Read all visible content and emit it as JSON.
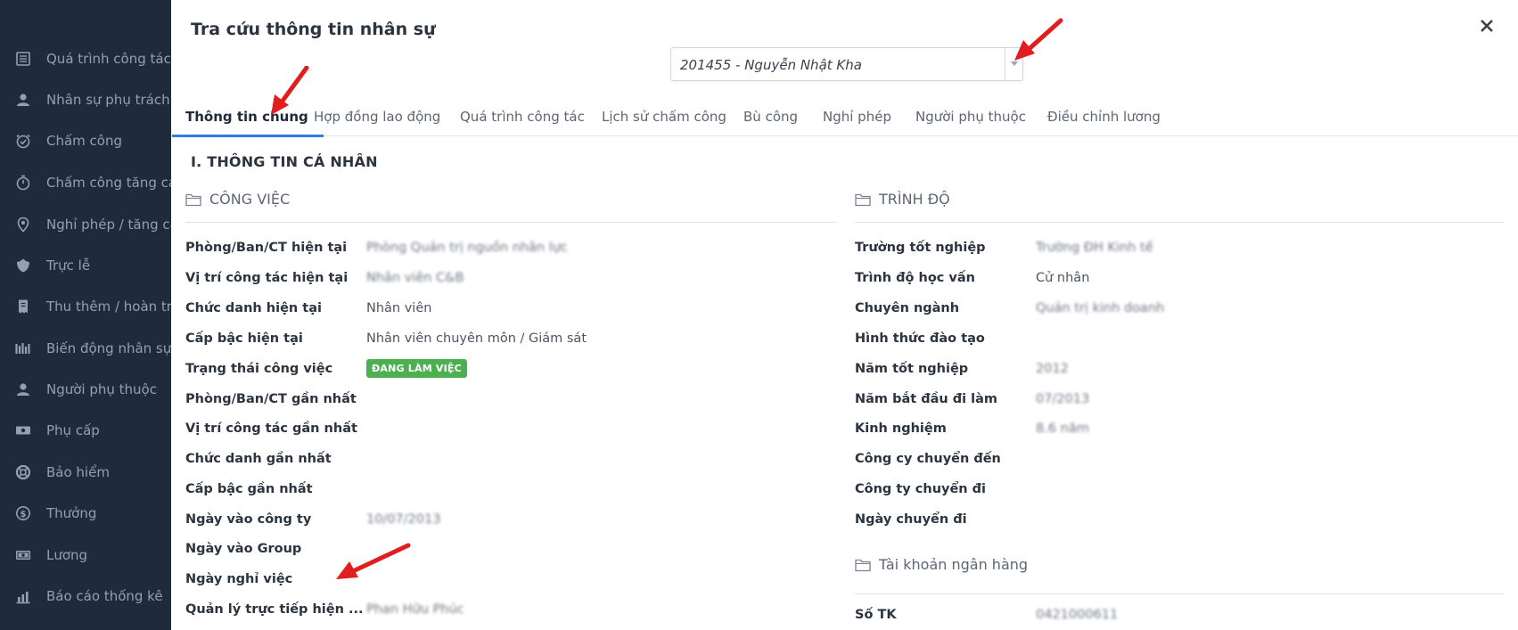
{
  "sidebar": {
    "items": [
      {
        "label": "Quá trình công tác n",
        "icon": "list-icon"
      },
      {
        "label": "Nhân sự phụ trách",
        "icon": "user-icon"
      },
      {
        "label": "Chấm công",
        "icon": "clock-check-icon"
      },
      {
        "label": "Chấm công tăng ca",
        "icon": "stopwatch-icon"
      },
      {
        "label": "Nghỉ phép / tăng ca",
        "icon": "location-icon"
      },
      {
        "label": "Trực lễ",
        "icon": "shield-icon"
      },
      {
        "label": "Thu thêm / hoàn trả",
        "icon": "receipt-icon"
      },
      {
        "label": "Biến động nhân sự",
        "icon": "wave-icon"
      },
      {
        "label": "Người phụ thuộc",
        "icon": "user-icon"
      },
      {
        "label": "Phụ cấp",
        "icon": "money-icon"
      },
      {
        "label": "Bảo hiểm",
        "icon": "lifebuoy-icon"
      },
      {
        "label": "Thưởng",
        "icon": "dollar-icon"
      },
      {
        "label": "Lương",
        "icon": "cash-icon"
      },
      {
        "label": "Báo cáo thống kê",
        "icon": "chart-icon"
      }
    ]
  },
  "modal": {
    "title": "Tra cứu thông tin nhân sự",
    "employee_select": {
      "value": "201455 - Nguyễn Nhật Kha"
    },
    "tabs": [
      {
        "label": "Thông tin chung",
        "active": true
      },
      {
        "label": "Hợp đồng lao động",
        "active": false
      },
      {
        "label": "Quá trình công tác",
        "active": false
      },
      {
        "label": "Lịch sử chấm công",
        "active": false
      },
      {
        "label": "Bù công",
        "active": false
      },
      {
        "label": "Nghỉ phép",
        "active": false
      },
      {
        "label": "Người phụ thuộc",
        "active": false
      },
      {
        "label": "Điều chỉnh lương",
        "active": false
      }
    ],
    "section_heading": "I. THÔNG TIN CÁ NHÂN",
    "work": {
      "title": "CÔNG VIỆC",
      "rows": [
        {
          "label": "Phòng/Ban/CT hiện tại",
          "value": "Phòng Quản trị nguồn nhân lực"
        },
        {
          "label": "Vị trí công tác hiện tại",
          "value": "Nhân viên C&B"
        },
        {
          "label": "Chức danh hiện tại",
          "value": "Nhân viên"
        },
        {
          "label": "Cấp bậc hiện tại",
          "value": "Nhân viên chuyên môn / Giám sát"
        },
        {
          "label": "Trạng thái công việc",
          "value": ""
        },
        {
          "label": "Phòng/Ban/CT gần nhất",
          "value": ""
        },
        {
          "label": "Vị trí công tác gần nhất",
          "value": ""
        },
        {
          "label": "Chức danh gần nhất",
          "value": ""
        },
        {
          "label": "Cấp bậc gần nhất",
          "value": ""
        },
        {
          "label": "Ngày vào công ty",
          "value": "10/07/2013"
        },
        {
          "label": "Ngày vào Group",
          "value": ""
        },
        {
          "label": "Ngày nghỉ việc",
          "value": ""
        },
        {
          "label": "Quản lý trực tiếp hiện ...",
          "value": "Phan Hữu Phúc"
        }
      ],
      "status_badge": "ĐANG LÀM VIỆC"
    },
    "education": {
      "title": "TRÌNH ĐỘ",
      "rows": [
        {
          "label": "Trường tốt nghiệp",
          "value": "Trường ĐH Kinh tế"
        },
        {
          "label": "Trình độ học vấn",
          "value": "Cử nhân"
        },
        {
          "label": "Chuyên ngành",
          "value": "Quản trị kinh doanh"
        },
        {
          "label": "Hình thức đào tạo",
          "value": ""
        },
        {
          "label": "Năm tốt nghiệp",
          "value": "2012"
        },
        {
          "label": "Năm bắt đầu đi làm",
          "value": "07/2013"
        },
        {
          "label": "Kinh nghiệm",
          "value": "8.6 năm"
        },
        {
          "label": "Công cy chuyển đến",
          "value": ""
        },
        {
          "label": "Công ty chuyển đi",
          "value": ""
        },
        {
          "label": "Ngày chuyển đi",
          "value": ""
        }
      ]
    },
    "bank": {
      "title": "Tài khoản ngân hàng",
      "rows": [
        {
          "label": "Số TK",
          "value": "0421000611"
        }
      ]
    }
  },
  "colors": {
    "sidebar_bg": "#1f2a3a",
    "tab_accent": "#2f7de1",
    "badge_green": "#4caf50",
    "annotation_arrow": "#e11d1d"
  }
}
